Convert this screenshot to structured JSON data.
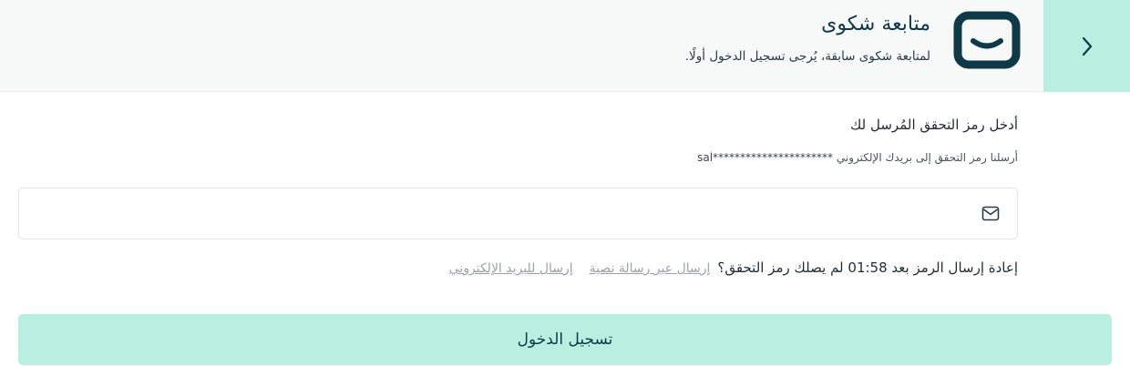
{
  "header": {
    "title": "متابعة شكوى",
    "subtitle": "لمتابعة شكوى سابقة، يُرجى تسجيل الدخول أولًا.",
    "logo_icon": "smile-box-logo-icon",
    "back_icon": "chevron-right-icon"
  },
  "form": {
    "heading": "أدخل رمز التحقق المُرسل لك",
    "sent_prefix": "أرسلنا رمز التحقق إلى بريدك الإلكتروني",
    "masked_email": "sal**********************",
    "code_placeholder": "",
    "field_icon": "envelope-icon"
  },
  "resend": {
    "text": "إعادة إرسال الرمز بعد 01:58 لم يصلك رمز التحقق؟",
    "sms_link": "إرسال عبر رسالة نصية",
    "email_link": "إرسال للبريد الإلكتروني"
  },
  "login_button": {
    "label": "تسجيل الدخول"
  },
  "colors": {
    "accent": "#b8efe1",
    "brand_dark": "#0e3a47",
    "header_bg": "#f7f8f8",
    "link_muted": "#9aa3a6"
  }
}
